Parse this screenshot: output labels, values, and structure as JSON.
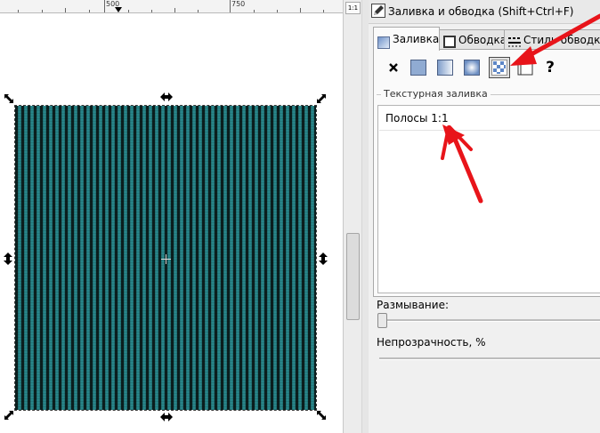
{
  "ruler": {
    "labels": [
      "500",
      "750"
    ]
  },
  "zoom_button": {
    "label": "1:1"
  },
  "panel": {
    "title": "Заливка и обводка (Shift+Ctrl+F)",
    "tabs": [
      {
        "label": "Заливка"
      },
      {
        "label": "Обводка"
      },
      {
        "label": "Стиль обводки"
      }
    ],
    "fill_buttons": [
      {
        "icon": "no-paint-icon",
        "glyph": "✕"
      },
      {
        "icon": "flat-color-icon"
      },
      {
        "icon": "linear-gradient-icon"
      },
      {
        "icon": "radial-gradient-icon"
      },
      {
        "icon": "pattern-icon"
      },
      {
        "icon": "swatch-icon"
      },
      {
        "icon": "unset-paint-icon",
        "glyph": "?"
      }
    ],
    "pattern_group_label": "Текстурная заливка",
    "pattern_selected": "Полосы 1:1",
    "blur_label": "Размывание:",
    "blur_value_fraction": 0.0,
    "opacity_label": "Непрозрачность, %"
  },
  "colors": {
    "stripe_dark": "#0b1f1f",
    "stripe_teal": "#2b8f94",
    "annotation_arrow": "#e8141a"
  }
}
